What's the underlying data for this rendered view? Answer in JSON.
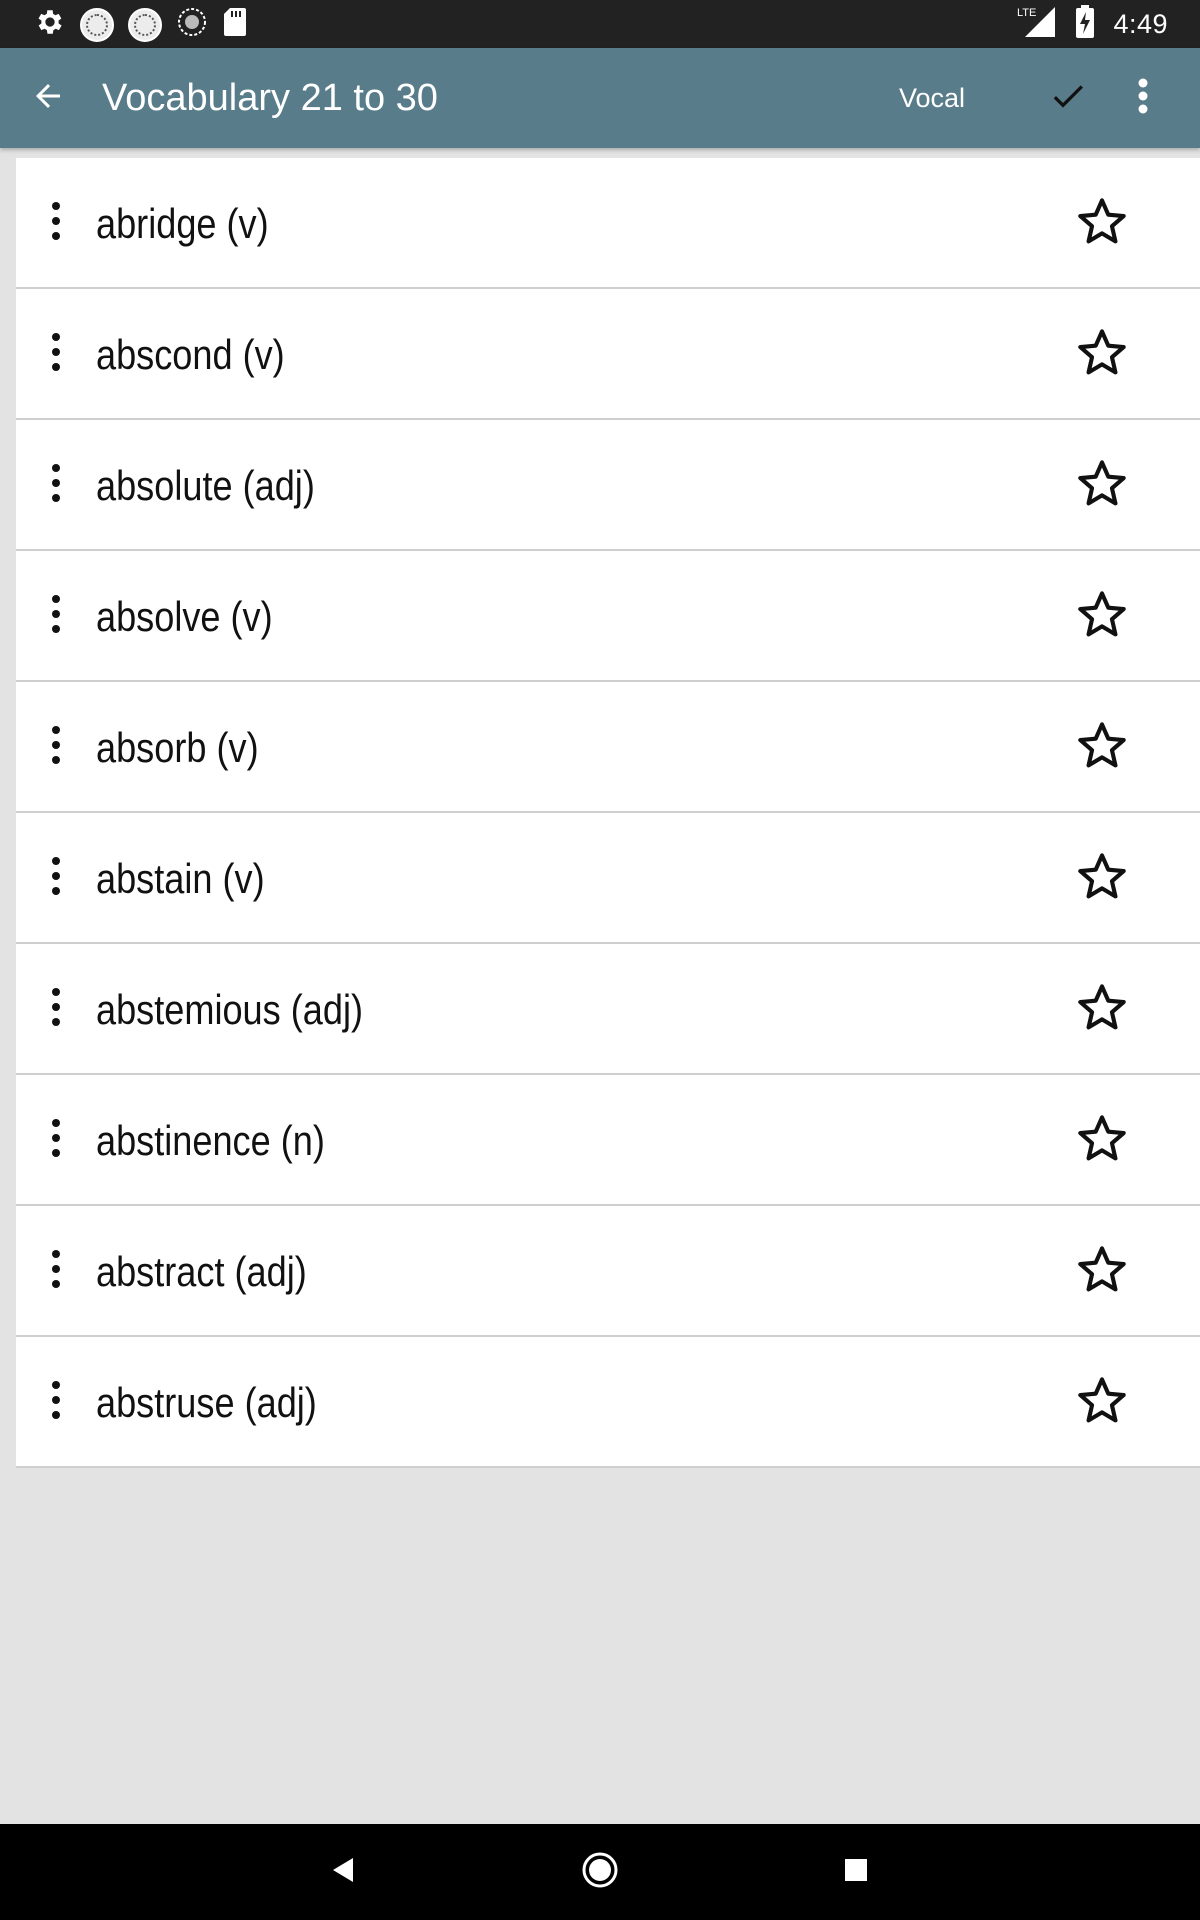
{
  "status_bar": {
    "time": "4:49",
    "network_label": "LTE",
    "icons": [
      "settings-icon",
      "gre-vocabulary-app-icon",
      "sat-vocabulary-app-icon",
      "sync-icon",
      "sd-card-icon"
    ]
  },
  "toolbar": {
    "title": "Vocabulary 21 to 30",
    "vocal_label": "Vocal",
    "back_icon": "arrow-left-icon",
    "check_icon": "check-icon",
    "overflow_icon": "more-vert-icon"
  },
  "words": [
    {
      "word": "abridge (v)",
      "starred": false
    },
    {
      "word": "abscond (v)",
      "starred": false
    },
    {
      "word": "absolute (adj)",
      "starred": false
    },
    {
      "word": "absolve (v)",
      "starred": false
    },
    {
      "word": "absorb (v)",
      "starred": false
    },
    {
      "word": "abstain (v)",
      "starred": false
    },
    {
      "word": "abstemious (adj)",
      "starred": false
    },
    {
      "word": "abstinence (n)",
      "starred": false
    },
    {
      "word": "abstract (adj)",
      "starred": false
    },
    {
      "word": "abstruse (adj)",
      "starred": false
    }
  ],
  "colors": {
    "app_bar": "#587c89",
    "status_bar": "#222222",
    "background": "#e3e3e3",
    "nav_bar": "#000000"
  }
}
